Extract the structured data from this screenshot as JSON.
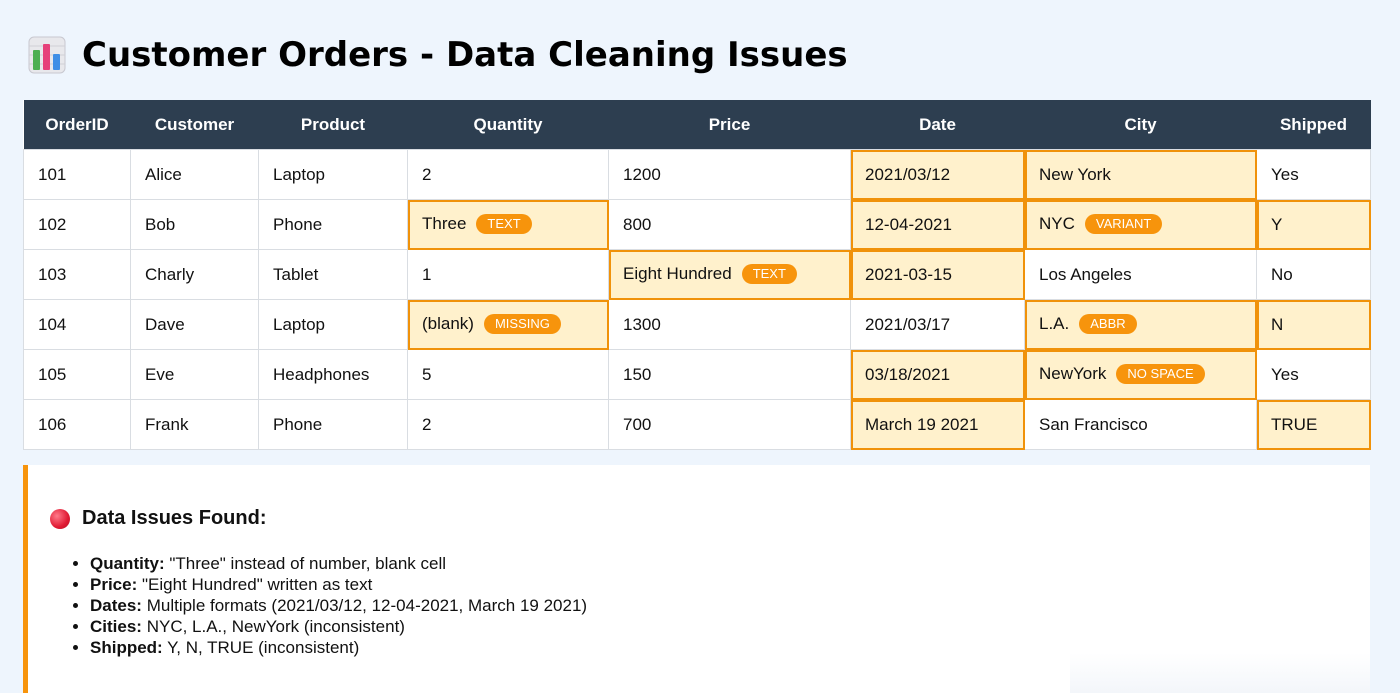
{
  "title": "Customer Orders - Data Cleaning Issues",
  "icon": "bar-chart-icon",
  "colors": {
    "header_bg": "#2d3e50",
    "highlight_bg": "#fff1cc",
    "highlight_border": "#f0920a",
    "badge_bg": "#f7940c",
    "issue_dot": "#e01a33"
  },
  "table": {
    "columns": [
      "OrderID",
      "Customer",
      "Product",
      "Quantity",
      "Price",
      "Date",
      "City",
      "Shipped"
    ],
    "rows": [
      {
        "order_id": "101",
        "customer": "Alice",
        "product": "Laptop",
        "quantity": "2",
        "price": "1200",
        "date": "2021/03/12",
        "city": "New York",
        "shipped": "Yes"
      },
      {
        "order_id": "102",
        "customer": "Bob",
        "product": "Phone",
        "quantity": "Three",
        "quantity_badge": "TEXT",
        "price": "800",
        "date": "12-04-2021",
        "city": "NYC",
        "city_badge": "VARIANT",
        "shipped": "Y"
      },
      {
        "order_id": "103",
        "customer": "Charly",
        "product": "Tablet",
        "quantity": "1",
        "price": "Eight Hundred",
        "price_badge": "TEXT",
        "date": "2021-03-15",
        "city": "Los Angeles",
        "shipped": "No"
      },
      {
        "order_id": "104",
        "customer": "Dave",
        "product": "Laptop",
        "quantity": "(blank)",
        "quantity_badge": "MISSING",
        "price": "1300",
        "date": "2021/03/17",
        "city": "L.A.",
        "city_badge": "ABBR",
        "shipped": "N"
      },
      {
        "order_id": "105",
        "customer": "Eve",
        "product": "Headphones",
        "quantity": "5",
        "price": "150",
        "date": "03/18/2021",
        "city": "NewYork",
        "city_badge": "NO SPACE",
        "shipped": "Yes"
      },
      {
        "order_id": "106",
        "customer": "Frank",
        "product": "Phone",
        "quantity": "2",
        "price": "700",
        "date": "March 19 2021",
        "city": "San Francisco",
        "shipped": "TRUE"
      }
    ]
  },
  "issues": {
    "icon": "red-circle-icon",
    "title": "Data Issues Found:",
    "items": [
      {
        "label": "Quantity:",
        "text": "\"Three\" instead of number, blank cell"
      },
      {
        "label": "Price:",
        "text": "\"Eight Hundred\" written as text"
      },
      {
        "label": "Dates:",
        "text": "Multiple formats (2021/03/12, 12-04-2021, March 19 2021)"
      },
      {
        "label": "Cities:",
        "text": "NYC, L.A., NewYork (inconsistent)"
      },
      {
        "label": "Shipped:",
        "text": "Y, N, TRUE (inconsistent)"
      }
    ]
  }
}
